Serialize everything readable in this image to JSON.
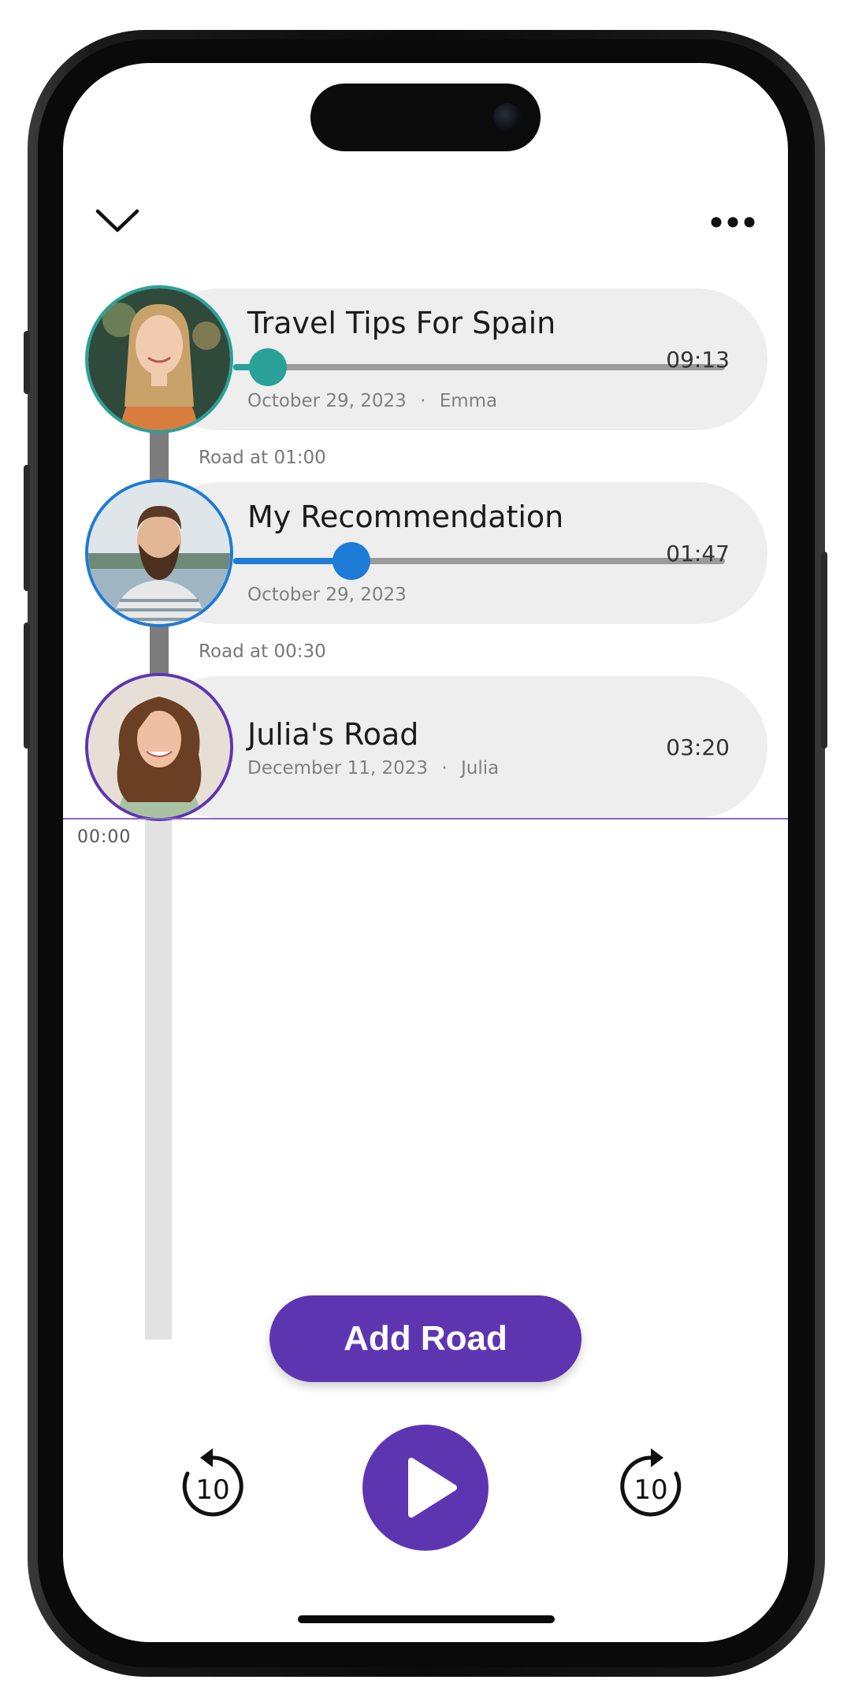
{
  "header": {
    "collapse_icon": "chevron-down-icon",
    "more_icon": "more-horizontal-icon"
  },
  "roads": [
    {
      "title": "Travel Tips For Spain",
      "date": "October 29, 2023",
      "separator": "·",
      "author": "Emma",
      "duration": "09:13",
      "progress": 0.07,
      "accent": "#2aa198",
      "road_at": "Road at 01:00"
    },
    {
      "title": "My Recommendation",
      "date": "October 29, 2023",
      "separator": "",
      "author": "",
      "duration": "01:47",
      "progress": 0.24,
      "accent": "#1e7bd6",
      "road_at": "Road at 00:30"
    },
    {
      "title": "Julia's Road",
      "date": "December 11, 2023",
      "separator": "·",
      "author": "Julia",
      "duration": "03:20",
      "accent": "#5e35b1"
    }
  ],
  "timeline": {
    "current_time": "00:00"
  },
  "controls": {
    "add_road_label": "Add Road",
    "rewind_value": "10",
    "forward_value": "10",
    "rewind_icon": "rewind-10-icon",
    "play_icon": "play-icon",
    "forward_icon": "forward-10-icon"
  },
  "colors": {
    "brand_purple": "#5e35b1",
    "card_bg": "#eeeeee"
  }
}
